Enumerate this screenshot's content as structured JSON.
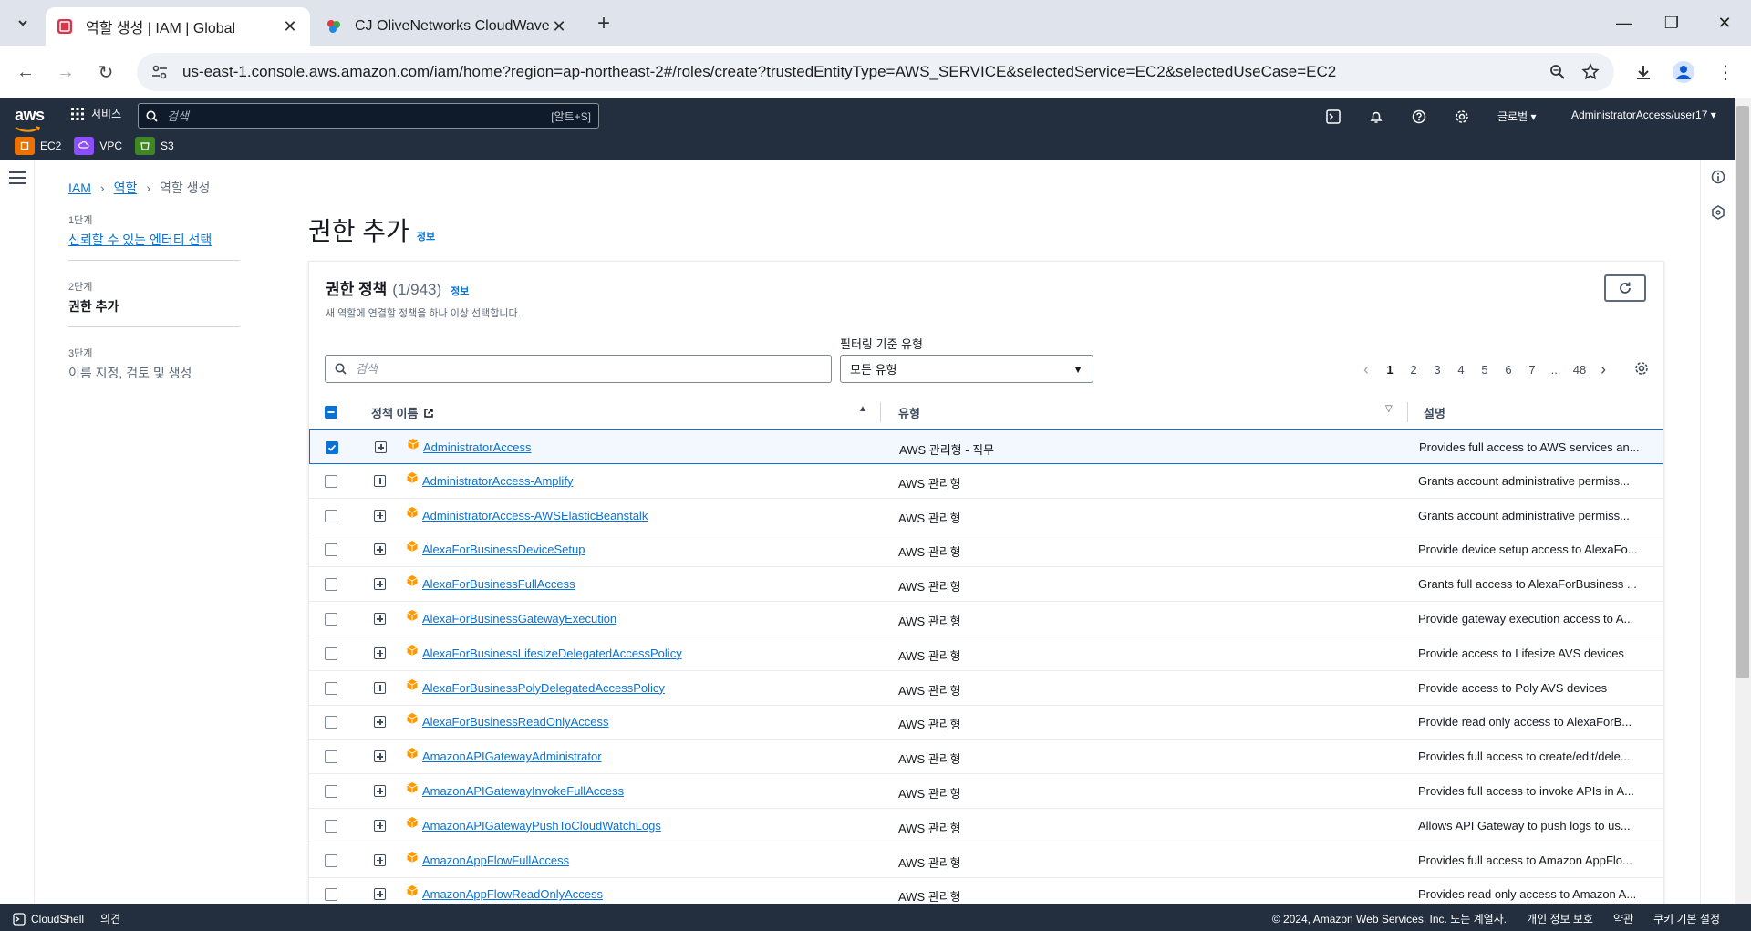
{
  "browser": {
    "tabs": [
      {
        "title": "역할 생성 | IAM | Global",
        "active": true
      },
      {
        "title": "CJ OliveNetworks CloudWave",
        "active": false
      }
    ],
    "url": "us-east-1.console.aws.amazon.com/iam/home?region=ap-northeast-2#/roles/create?trustedEntityType=AWS_SERVICE&selectedService=EC2&selectedUseCase=EC2"
  },
  "aws_nav": {
    "logo": "aws",
    "services_label": "서비스",
    "search_placeholder": "검색",
    "search_shortcut": "[알트+S]",
    "region": "글로벌",
    "account": "AdministratorAccess/user17",
    "favorites": [
      {
        "label": "EC2",
        "color": "#ed7100"
      },
      {
        "label": "VPC",
        "color": "#8c4fff"
      },
      {
        "label": "S3",
        "color": "#3f8624"
      }
    ]
  },
  "breadcrumb": {
    "items": [
      "IAM",
      "역할",
      "역할 생성"
    ]
  },
  "steps": [
    {
      "num": "1단계",
      "label": "신뢰할 수 있는 엔터티 선택"
    },
    {
      "num": "2단계",
      "label": "권한 추가"
    },
    {
      "num": "3단계",
      "label": "이름 지정, 검토 및 생성"
    }
  ],
  "page": {
    "title": "권한 추가",
    "info": "정보"
  },
  "panel": {
    "title": "권한 정책",
    "count": "(1/943)",
    "info": "정보",
    "description": "새 역할에 연결할 정책을 하나 이상 선택합니다.",
    "search_placeholder": "검색",
    "filter_label": "필터링 기준 유형",
    "filter_value": "모든 유형",
    "pages": [
      "1",
      "2",
      "3",
      "4",
      "5",
      "6",
      "7",
      "...",
      "48"
    ],
    "current_page": "1",
    "columns": {
      "name": "정책 이름",
      "type": "유형",
      "desc": "설명"
    }
  },
  "policies": [
    {
      "name": "AdministratorAccess",
      "type": "AWS 관리형 - 직무",
      "desc": "Provides full access to AWS services an...",
      "selected": true
    },
    {
      "name": "AdministratorAccess-Amplify",
      "type": "AWS 관리형",
      "desc": "Grants account administrative permiss...",
      "selected": false
    },
    {
      "name": "AdministratorAccess-AWSElasticBeanstalk",
      "type": "AWS 관리형",
      "desc": "Grants account administrative permiss...",
      "selected": false
    },
    {
      "name": "AlexaForBusinessDeviceSetup",
      "type": "AWS 관리형",
      "desc": "Provide device setup access to AlexaFo...",
      "selected": false
    },
    {
      "name": "AlexaForBusinessFullAccess",
      "type": "AWS 관리형",
      "desc": "Grants full access to AlexaForBusiness ...",
      "selected": false
    },
    {
      "name": "AlexaForBusinessGatewayExecution",
      "type": "AWS 관리형",
      "desc": "Provide gateway execution access to A...",
      "selected": false
    },
    {
      "name": "AlexaForBusinessLifesizeDelegatedAccessPolicy",
      "type": "AWS 관리형",
      "desc": "Provide access to Lifesize AVS devices",
      "selected": false
    },
    {
      "name": "AlexaForBusinessPolyDelegatedAccessPolicy",
      "type": "AWS 관리형",
      "desc": "Provide access to Poly AVS devices",
      "selected": false
    },
    {
      "name": "AlexaForBusinessReadOnlyAccess",
      "type": "AWS 관리형",
      "desc": "Provide read only access to AlexaForB...",
      "selected": false
    },
    {
      "name": "AmazonAPIGatewayAdministrator",
      "type": "AWS 관리형",
      "desc": "Provides full access to create/edit/dele...",
      "selected": false
    },
    {
      "name": "AmazonAPIGatewayInvokeFullAccess",
      "type": "AWS 관리형",
      "desc": "Provides full access to invoke APIs in A...",
      "selected": false
    },
    {
      "name": "AmazonAPIGatewayPushToCloudWatchLogs",
      "type": "AWS 관리형",
      "desc": "Allows API Gateway to push logs to us...",
      "selected": false
    },
    {
      "name": "AmazonAppFlowFullAccess",
      "type": "AWS 관리형",
      "desc": "Provides full access to Amazon AppFlo...",
      "selected": false
    },
    {
      "name": "AmazonAppFlowReadOnlyAccess",
      "type": "AWS 관리형",
      "desc": "Provides read only access to Amazon A...",
      "selected": false
    }
  ],
  "footer": {
    "cloudshell": "CloudShell",
    "feedback": "의견",
    "copyright": "© 2024, Amazon Web Services, Inc. 또는 계열사.",
    "privacy": "개인 정보 보호",
    "terms": "약관",
    "cookies": "쿠키 기본 설정"
  }
}
